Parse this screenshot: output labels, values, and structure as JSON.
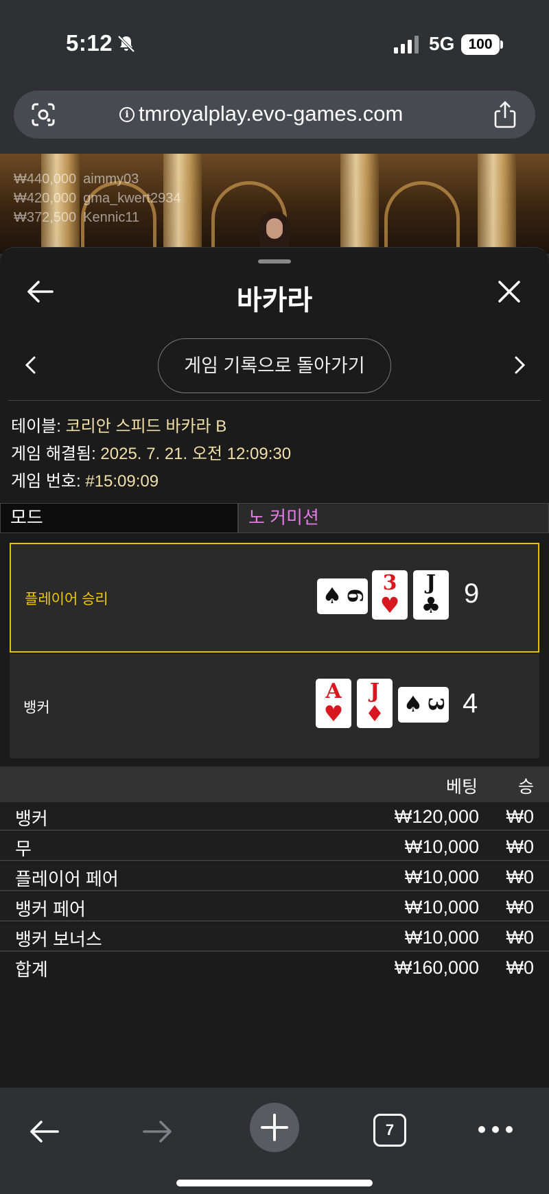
{
  "status_bar": {
    "time": "5:12",
    "network": "5G",
    "battery": "100"
  },
  "browser": {
    "url": "tmroyalplay.evo-games.com",
    "tab_count": "7"
  },
  "video_overlay": {
    "winners": [
      {
        "amount": "₩440,000",
        "name": "aimmy03"
      },
      {
        "amount": "₩420,000",
        "name": "gma_kwert2934"
      },
      {
        "amount": "₩372,500",
        "name": "Kennic11"
      }
    ]
  },
  "sheet": {
    "title": "바카라",
    "return_button": "게임 기록으로 돌아가기"
  },
  "game_info": {
    "table_key": "테이블: ",
    "table_value": "코리안 스피드 바카라 B",
    "resolved_key": "게임 해결됨: ",
    "resolved_value": "2025. 7. 21. 오전 12:09:30",
    "number_key": "게임 번호: ",
    "number_value": "#15:09:09"
  },
  "mode": {
    "label": "모드",
    "value": "노 커미션"
  },
  "hands": {
    "player": {
      "label": "플레이어 승리",
      "score": "9",
      "cards": [
        {
          "rank": "6",
          "suit": "♠",
          "color": "#111111",
          "orientation": "side"
        },
        {
          "rank": "3",
          "suit": "♥",
          "color": "#d7191f",
          "orientation": "up"
        },
        {
          "rank": "J",
          "suit": "♣",
          "color": "#111111",
          "orientation": "up"
        }
      ]
    },
    "banker": {
      "label": "뱅커",
      "score": "4",
      "cards": [
        {
          "rank": "A",
          "suit": "♥",
          "color": "#d7191f",
          "orientation": "up"
        },
        {
          "rank": "J",
          "suit": "♦",
          "color": "#d7191f",
          "orientation": "up"
        },
        {
          "rank": "3",
          "suit": "♠",
          "color": "#111111",
          "orientation": "side"
        }
      ]
    }
  },
  "bets": {
    "col_bet": "베팅",
    "col_win": "승",
    "rows": [
      {
        "name": "뱅커",
        "bet": "₩120,000",
        "win": "₩0"
      },
      {
        "name": "무",
        "bet": "₩10,000",
        "win": "₩0"
      },
      {
        "name": "플레이어 페어",
        "bet": "₩10,000",
        "win": "₩0"
      },
      {
        "name": "뱅커 페어",
        "bet": "₩10,000",
        "win": "₩0"
      },
      {
        "name": "뱅커 보너스",
        "bet": "₩10,000",
        "win": "₩0"
      }
    ],
    "total": {
      "name": "합계",
      "bet": "₩160,000",
      "win": "₩0"
    }
  },
  "colors": {
    "accent_gold": "#e7c200",
    "mode_purple": "#e27be6",
    "info_value": "#f3dfa8"
  },
  "icons": {
    "status": [
      "bell-slash-icon",
      "signal-icon"
    ],
    "urlbar": [
      "lens-icon",
      "info-icon",
      "share-icon"
    ],
    "toolbar": [
      "back-arrow-icon",
      "forward-arrow-icon",
      "plus-icon",
      "tabs-icon",
      "more-icon"
    ]
  }
}
